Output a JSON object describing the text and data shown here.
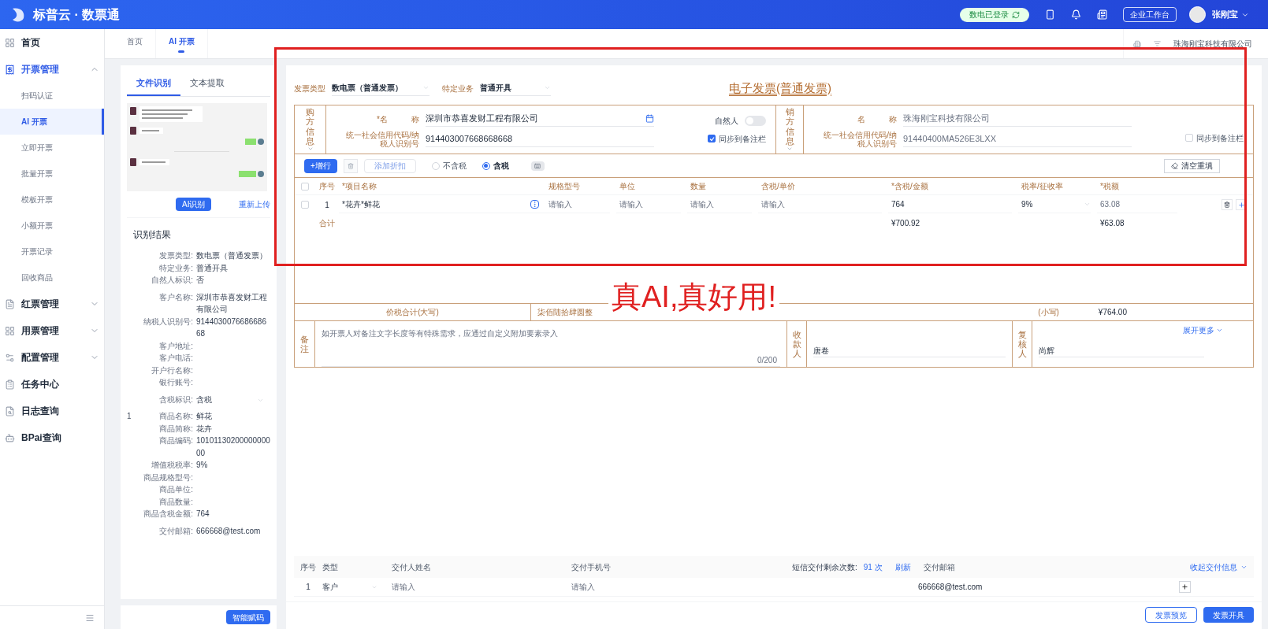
{
  "header": {
    "logo": "标普云 · 数票通",
    "status_badge": "数电已登录",
    "workspace_button": "企业工作台",
    "user_name": "张刚宝"
  },
  "sidebar": {
    "items": [
      {
        "label": "首页"
      },
      {
        "label": "开票管理",
        "expanded": true,
        "children": [
          {
            "label": "扫码认证",
            "selected": false
          },
          {
            "label": "AI 开票",
            "selected": true
          },
          {
            "label": "立即开票",
            "selected": false
          },
          {
            "label": "批量开票",
            "selected": false
          },
          {
            "label": "模板开票",
            "selected": false
          },
          {
            "label": "小额开票",
            "selected": false
          },
          {
            "label": "开票记录",
            "selected": false
          },
          {
            "label": "回收商品",
            "selected": false
          }
        ]
      },
      {
        "label": "红票管理",
        "expanded": false
      },
      {
        "label": "用票管理",
        "expanded": false
      },
      {
        "label": "配置管理",
        "expanded": false
      },
      {
        "label": "任务中心"
      },
      {
        "label": "日志查询"
      },
      {
        "label": "BPai查询"
      }
    ]
  },
  "tabs": [
    {
      "label": "首页",
      "selected": false
    },
    {
      "label": "AI 开票",
      "selected": true
    }
  ],
  "company": "珠海刚宝科技有限公司",
  "recognition": {
    "tabs": [
      {
        "label": "文件识别",
        "selected": true
      },
      {
        "label": "文本提取",
        "selected": false
      }
    ],
    "ai_button": "AI识别",
    "reupload_link": "重新上传",
    "result_title": "识别结果",
    "groups": [
      {
        "fields": [
          {
            "label": "发票类型:",
            "value": "数电票（普通发票）"
          },
          {
            "label": "特定业务:",
            "value": "普通开具"
          },
          {
            "label": "自然人标识:",
            "value": "否"
          }
        ]
      },
      {
        "fields": [
          {
            "label": "客户名称:",
            "value": "深圳市恭喜发财工程有限公司"
          },
          {
            "label": "纳税人识别号:",
            "value": "914403007668668668"
          },
          {
            "label": "客户地址:"
          },
          {
            "label": "客户电话:"
          },
          {
            "label": "开户行名称:"
          },
          {
            "label": "银行账号:"
          }
        ]
      },
      {
        "fields": [
          {
            "label": "含税标识:",
            "value": "含税",
            "kind": "select"
          }
        ]
      },
      {
        "index": "1",
        "fields": [
          {
            "label": "商品名称:",
            "value": "鲜花"
          },
          {
            "label": "商品简称:",
            "value": "花卉"
          },
          {
            "label": "商品编码:",
            "value": "1010113020000000000"
          },
          {
            "label": "增值税税率:",
            "value": "9%"
          },
          {
            "label": "商品规格型号:"
          },
          {
            "label": "商品单位:"
          },
          {
            "label": "商品数量:"
          },
          {
            "label": "商品含税金额:",
            "value": "764"
          }
        ]
      },
      {
        "fields": [
          {
            "label": "交付邮箱:",
            "value": "666668@test.com"
          }
        ]
      }
    ],
    "smart_button": "智能赋码"
  },
  "invoice": {
    "type_label": "发票类型",
    "type_value": "数电票（普通发票）",
    "business_label": "特定业务",
    "business_value": "普通开具",
    "title": "电子发票(普通发票)",
    "buyer": {
      "section": "购方信息",
      "name_label": "*名　　　称",
      "name": "深圳市恭喜发财工程有限公司",
      "id_label": "统一社会信用代码/纳税人识别号",
      "id": "914403007668668668",
      "natural_person_label": "自然人",
      "natural_person": false,
      "sync_label": "同步到备注栏",
      "sync": true
    },
    "seller": {
      "section": "销方信息",
      "name_label": "名　　　称",
      "name": "珠海刚宝科技有限公司",
      "id_label": "统一社会信用代码/纳税人识别号",
      "id": "91440400MA526E3LXX",
      "sync_label": "同步到备注栏",
      "sync": false
    },
    "add_row": "+增行",
    "discount": "添加折扣",
    "tax_modes": [
      {
        "label": "不含税",
        "selected": false
      },
      {
        "label": "含税",
        "selected": true
      }
    ],
    "clear": "清空重填",
    "select_all": false,
    "columns": [
      "序号",
      "*项目名称",
      "规格型号",
      "单位",
      "数量",
      "含税/单价",
      "*含税/金额",
      "税率/征收率",
      "*税额"
    ],
    "rows": [
      {
        "checked": false,
        "index": "1",
        "item": "*花卉*鲜花",
        "spec": "请输入",
        "unit": "请输入",
        "qty": "请输入",
        "price": "请输入",
        "amount": "764",
        "rate": "9%",
        "tax": "63.08"
      }
    ],
    "total_label": "合计",
    "total_amount": "¥700.92",
    "total_tax": "¥63.08",
    "sum_upper_label": "价税合计(大写)",
    "sum_upper": "柒佰陆拾肆圆整",
    "sum_lower_label": "(小写)",
    "sum_lower": "¥764.00",
    "remark_label": "备注",
    "remark_placeholder": "如开票人对备注文字长度等有特殊需求，应通过自定义附加要素录入",
    "remark_count": "0/200",
    "payee_label": "收款人",
    "payee": "唐卷",
    "reviewer_label": "复核人",
    "reviewer": "尚辉",
    "more": "展开更多"
  },
  "annotation": "真AI,真好用!",
  "delivery": {
    "columns": [
      "序号",
      "类型",
      "交付人姓名",
      "交付手机号"
    ],
    "sms_label": "短信交付剩余次数:",
    "sms_count": "91 次",
    "refresh": "刷新",
    "email_label": "交付邮箱",
    "collapse": "收起交付信息",
    "rows": [
      {
        "index": "1",
        "type": "客户",
        "name": "请输入",
        "phone": "请输入",
        "email": "666668@test.com"
      }
    ]
  },
  "actions": [
    "发票预览",
    "发票开具"
  ]
}
